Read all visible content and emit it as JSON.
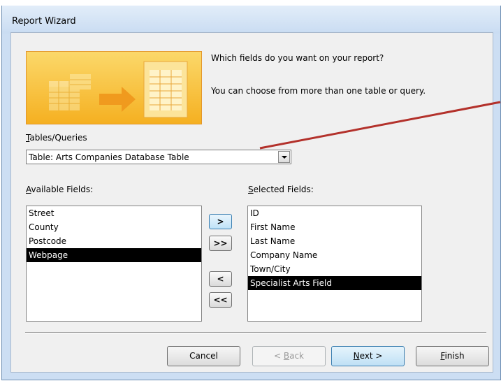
{
  "window": {
    "title": "Report Wizard"
  },
  "header": {
    "question": "Which fields do you want on your report?",
    "hint": "You can choose from more than one table or query."
  },
  "tables": {
    "label_mnemonic": "T",
    "label_rest": "ables/Queries",
    "selected": "Table: Arts Companies Database Table"
  },
  "available": {
    "label_mnemonic": "A",
    "label_rest": "vailable Fields:",
    "items": [
      "Street",
      "County",
      "Postcode",
      "Webpage"
    ],
    "selected_index": 3
  },
  "selected_fields": {
    "label_mnemonic": "S",
    "label_rest": "elected Fields:",
    "items": [
      "ID",
      "First Name",
      "Last Name",
      "Company Name",
      "Town/City",
      "Specialist Arts Field"
    ],
    "selected_index": 5
  },
  "move_buttons": {
    "add": ">",
    "add_all": ">>",
    "remove": "<",
    "remove_all": "<<"
  },
  "buttons": {
    "cancel": "Cancel",
    "back_prefix": "< ",
    "back_mnemonic": "B",
    "back_rest": "ack",
    "next_mnemonic": "N",
    "next_rest": "ext >",
    "finish_mnemonic": "F",
    "finish_rest": "inish"
  },
  "colors": {
    "annotation_arrow": "#b3312b",
    "frame": "#ccdef3",
    "banner": "#f5b021",
    "selection": "#000000"
  }
}
